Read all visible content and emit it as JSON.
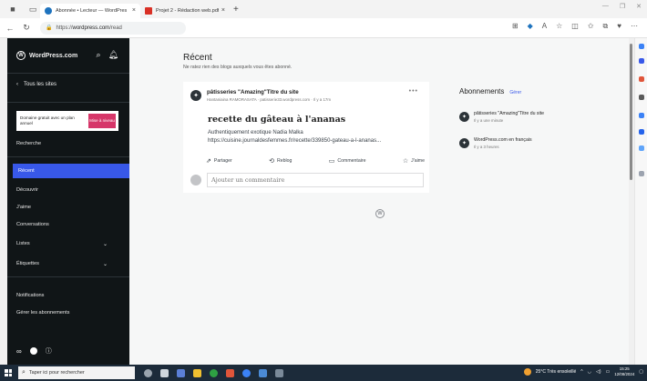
{
  "browser": {
    "tabs": [
      {
        "title": "Abonnée • Lecteur — WordPres",
        "close": "×",
        "active": true,
        "favicon_color": "#1e73be"
      },
      {
        "title": "Projet 2 - Rédaction web.pdf",
        "close": "×",
        "active": false,
        "favicon_color": "#d93025"
      }
    ],
    "new_tab": "+",
    "url_prefix": "https://",
    "url_domain": "wordpress.com",
    "url_path": "/read"
  },
  "sidebar": {
    "brand": "WordPress.com",
    "all_sites": "Tous les sites",
    "promo_text": "Domaine gratuit avec un plan annuel",
    "promo_button": "Mise à niveau",
    "search": "Recherche",
    "items": [
      {
        "label": "Récent",
        "active": true
      },
      {
        "label": "Découvrir"
      },
      {
        "label": "J'aime"
      },
      {
        "label": "Conversations"
      },
      {
        "label": "Listes",
        "chevron": true
      },
      {
        "label": "Étiquettes",
        "chevron": true
      }
    ],
    "notifications": "Notifications",
    "manage_subs": "Gérer les abonnements"
  },
  "main": {
    "title": "Récent",
    "subtitle": "Ne ratez rien des blogs auxquels vous êtes abonné.",
    "post": {
      "blog_name": "pâtisseries \"Amazing\"Titre du site",
      "meta": "Hantaniaina RAMORASATA · patisserie33.wordpress.com · Il y a 17m",
      "title": "recette du gâteau à l'ananas",
      "excerpt_line1": "Authentiquement exotique Nadia Malka",
      "excerpt_line2": "https://cuisine.journaldesfemmes.fr/recette/339850-gateau-a-l-ananas...",
      "actions": {
        "share": "Partager",
        "reblog": "Reblog",
        "comment": "Commentaire",
        "like": "J'aime"
      },
      "comment_placeholder": "Ajouter un commentaire"
    },
    "subscriptions": {
      "title": "Abonnements",
      "manage": "Gérer",
      "items": [
        {
          "name": "pâtisseries \"Amazing\"Titre du site",
          "time": "Il y a une minute"
        },
        {
          "name": "WordPress.com en français",
          "time": "Il y a 3 heures"
        }
      ]
    }
  },
  "taskbar": {
    "search_placeholder": "Taper ici pour rechercher",
    "weather": "25°C  Très ensoleillé",
    "time": "15:25",
    "date": "12/08/2024"
  }
}
